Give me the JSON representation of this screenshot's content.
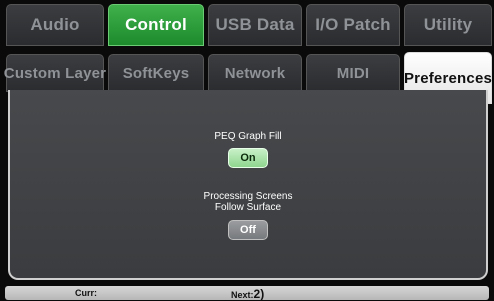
{
  "tabs_top": [
    {
      "label": "Audio"
    },
    {
      "label": "Control"
    },
    {
      "label": "USB Data"
    },
    {
      "label": "I/O Patch"
    },
    {
      "label": "Utility"
    }
  ],
  "tabs_sub": [
    {
      "label": "Custom Layer"
    },
    {
      "label": "SoftKeys"
    },
    {
      "label": "Network"
    },
    {
      "label": "MIDI"
    },
    {
      "label": "Preferences"
    }
  ],
  "active_top_tab": "Control",
  "active_sub_tab": "Preferences",
  "settings": {
    "peq": {
      "label": "PEQ Graph Fill",
      "value": "On"
    },
    "processing_line1": "Processing Screens",
    "processing_line2": "Follow Surface",
    "processing_value": "Off"
  },
  "status": {
    "curr_label": "Curr:",
    "next_label": "Next:",
    "next_value": "2)"
  },
  "colors": {
    "active_tab": "#2a9c38",
    "on_button": "#a8e4a8",
    "off_button": "#8a8c8f",
    "panel_bg": "#424447"
  }
}
